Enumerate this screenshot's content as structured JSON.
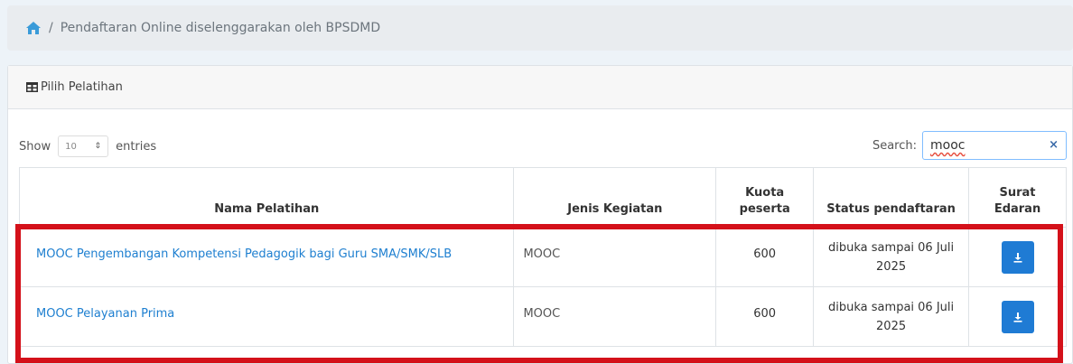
{
  "breadcrumb": {
    "home_icon": "home-icon",
    "separator": "/",
    "current": "Pendaftaran Online diselenggarakan oleh BPSDMD"
  },
  "card": {
    "header_icon": "table-grid-icon",
    "title": "Pilih Pelatihan"
  },
  "controls": {
    "show_label": "Show",
    "entries_value": "10",
    "entries_label": "entries",
    "search_label": "Search:",
    "search_value": "mooc",
    "clear_label": "×"
  },
  "table": {
    "headers": {
      "nama": "Nama Pelatihan",
      "jenis": "Jenis Kegiatan",
      "kuota_line1": "Kuota",
      "kuota_line2": "peserta",
      "status": "Status pendaftaran",
      "surat_line1": "Surat",
      "surat_line2": "Edaran"
    },
    "rows": [
      {
        "nama": "MOOC Pengembangan Kompetensi Pedagogik bagi Guru SMA/SMK/SLB",
        "jenis": "MOOC",
        "kuota": "600",
        "status_line1": "dibuka sampai 06 Juli",
        "status_line2": "2025",
        "download_icon": "download-icon"
      },
      {
        "nama": "MOOC Pelayanan Prima",
        "jenis": "MOOC",
        "kuota": "600",
        "status_line1": "dibuka sampai 06 Juli",
        "status_line2": "2025",
        "download_icon": "download-icon"
      }
    ]
  },
  "colors": {
    "link": "#1e7fd0",
    "button": "#1f7bd4",
    "highlight": "#d4111a"
  }
}
